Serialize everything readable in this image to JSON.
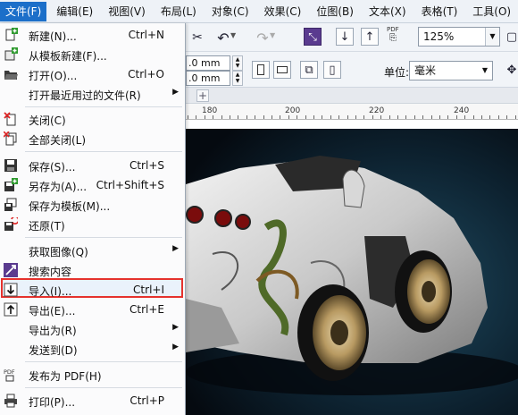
{
  "menubar": {
    "items": [
      "文件(F)",
      "编辑(E)",
      "视图(V)",
      "布局(L)",
      "对象(C)",
      "效果(C)",
      "位图(B)",
      "文本(X)",
      "表格(T)",
      "工具(O)"
    ]
  },
  "toolbar": {
    "zoom_value": "125%",
    "pdf_label": "PDF",
    "unit_label": "单位:",
    "unit_value": "毫米",
    "width_value": ".0 mm",
    "height_value": ".0 mm"
  },
  "ruler": {
    "labels": [
      "180",
      "200",
      "220",
      "240"
    ]
  },
  "file_menu": {
    "items": [
      {
        "label": "新建(N)...",
        "shortcut": "Ctrl+N",
        "submenu": false,
        "icon": "new-doc-icon"
      },
      {
        "label": "从模板新建(F)...",
        "shortcut": "",
        "submenu": false,
        "icon": "template-icon"
      },
      {
        "label": "打开(O)...",
        "shortcut": "Ctrl+O",
        "submenu": false,
        "icon": "open-folder-icon"
      },
      {
        "label": "打开最近用过的文件(R)",
        "shortcut": "",
        "submenu": true,
        "icon": ""
      },
      {
        "label": "关闭(C)",
        "shortcut": "",
        "submenu": false,
        "icon": "close-doc-icon"
      },
      {
        "label": "全部关闭(L)",
        "shortcut": "",
        "submenu": false,
        "icon": "close-all-icon"
      },
      {
        "label": "保存(S)...",
        "shortcut": "Ctrl+S",
        "submenu": false,
        "icon": "save-icon"
      },
      {
        "label": "另存为(A)...",
        "shortcut": "Ctrl+Shift+S",
        "submenu": false,
        "icon": "save-as-icon"
      },
      {
        "label": "保存为模板(M)...",
        "shortcut": "",
        "submenu": false,
        "icon": "save-template-icon"
      },
      {
        "label": "还原(T)",
        "shortcut": "",
        "submenu": false,
        "icon": "revert-icon"
      },
      {
        "label": "获取图像(Q)",
        "shortcut": "",
        "submenu": true,
        "icon": ""
      },
      {
        "label": "搜索内容",
        "shortcut": "",
        "submenu": false,
        "icon": "search-content-icon"
      },
      {
        "label": "导入(I)...",
        "shortcut": "Ctrl+I",
        "submenu": false,
        "icon": "import-icon"
      },
      {
        "label": "导出(E)...",
        "shortcut": "Ctrl+E",
        "submenu": false,
        "icon": "export-icon"
      },
      {
        "label": "导出为(R)",
        "shortcut": "",
        "submenu": true,
        "icon": ""
      },
      {
        "label": "发送到(D)",
        "shortcut": "",
        "submenu": true,
        "icon": ""
      },
      {
        "label": "发布为 PDF(H)",
        "shortcut": "",
        "submenu": false,
        "icon": "publish-pdf-icon"
      },
      {
        "label": "打印(P)...",
        "shortcut": "Ctrl+P",
        "submenu": false,
        "icon": "print-icon"
      }
    ]
  },
  "colors": {
    "accent": "#1c6fc9",
    "highlight_border": "#e5322d",
    "canvas_bg": "#0d2230"
  }
}
